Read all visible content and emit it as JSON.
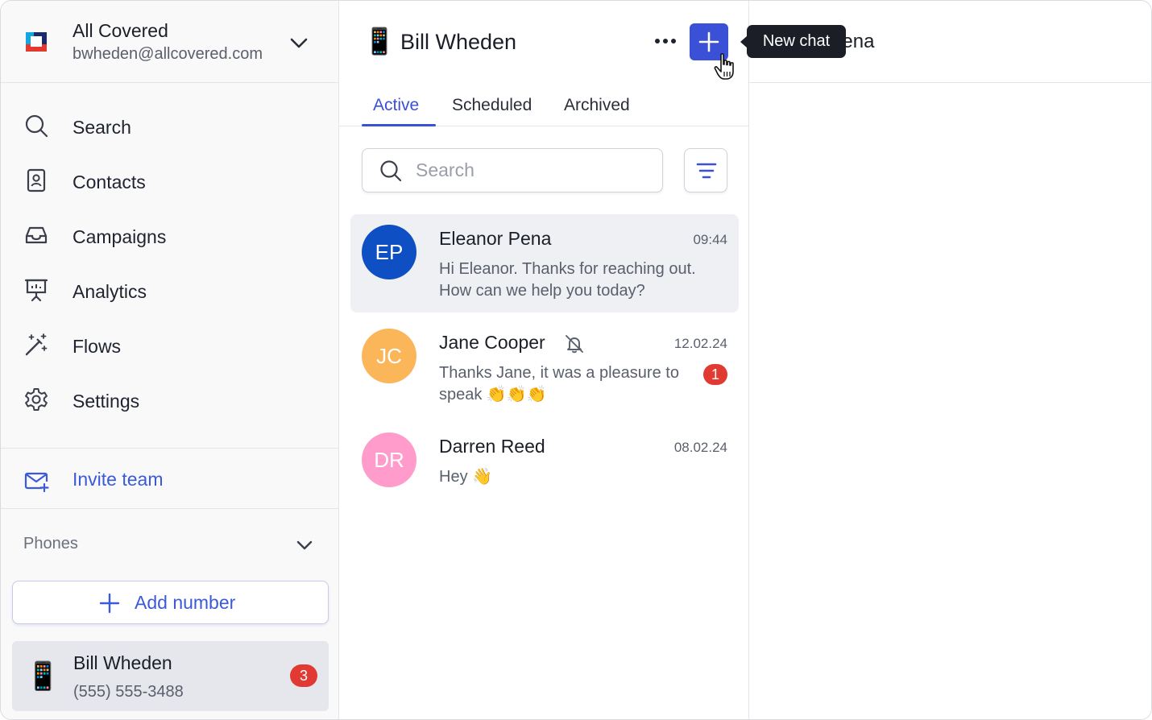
{
  "account": {
    "name": "All Covered",
    "email": "bwheden@allcovered.com"
  },
  "nav": {
    "items": [
      {
        "label": "Search",
        "icon": "search-icon"
      },
      {
        "label": "Contacts",
        "icon": "contact-book-icon"
      },
      {
        "label": "Campaigns",
        "icon": "inbox-icon"
      },
      {
        "label": "Analytics",
        "icon": "presentation-chart-icon"
      },
      {
        "label": "Flows",
        "icon": "magic-wand-icon"
      },
      {
        "label": "Settings",
        "icon": "gear-icon"
      }
    ],
    "invite_label": "Invite team"
  },
  "phones": {
    "header": "Phones",
    "add_label": "Add number",
    "items": [
      {
        "emoji": "📱",
        "name": "Bill Wheden",
        "number": "(555) 555-3488",
        "badge": "3"
      }
    ]
  },
  "inbox": {
    "emoji": "📱",
    "title": "Bill Wheden",
    "tooltip": "New chat",
    "tabs": [
      {
        "label": "Active"
      },
      {
        "label": "Scheduled"
      },
      {
        "label": "Archived"
      }
    ],
    "search_placeholder": "Search",
    "conversations": [
      {
        "initials": "EP",
        "name": "Eleanor Pena",
        "time": "09:44",
        "preview": "Hi Eleanor. Thanks for reaching out. How can we help you today?",
        "avatar_color": "#0f4fc4"
      },
      {
        "initials": "JC",
        "name": "Jane Cooper",
        "time": "12.02.24",
        "preview": "Thanks Jane, it was a pleasure to speak 👏👏👏",
        "unread": "1",
        "avatar_color": "#fbb65a"
      },
      {
        "initials": "DR",
        "name": "Darren Reed",
        "time": "08.02.24",
        "preview": "Hey 👋",
        "avatar_color": "#ff9ccc"
      }
    ]
  },
  "detail": {
    "title": "Eleanor Pena"
  },
  "colors": {
    "accent": "#3a50d6",
    "badge": "#e03a32"
  }
}
